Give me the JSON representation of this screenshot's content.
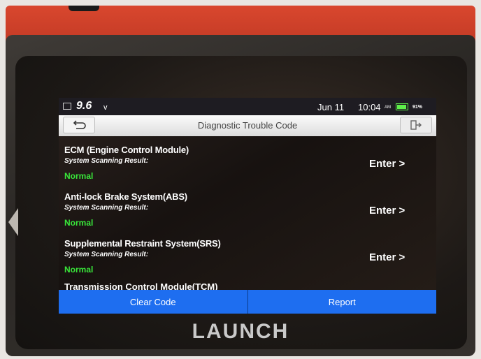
{
  "status_bar": {
    "voltage": "9.6",
    "voltage_unit": "v",
    "date": "Jun 11",
    "time": "10:04",
    "ampm": "AM",
    "battery_percent": "91%",
    "battery_level": 0.91
  },
  "header": {
    "title": "Diagnostic Trouble Code",
    "back_icon": "back-arrow-icon",
    "exit_icon": "exit-icon"
  },
  "modules": [
    {
      "name": "ECM (Engine Control Module)",
      "subtitle": "System Scanning Result:",
      "result": "Normal",
      "action": "Enter >"
    },
    {
      "name": "Anti-lock Brake System(ABS)",
      "subtitle": "System Scanning Result:",
      "result": "Normal",
      "action": "Enter >"
    },
    {
      "name": "Supplemental Restraint System(SRS)",
      "subtitle": "System Scanning Result:",
      "result": "Normal",
      "action": "Enter >"
    },
    {
      "name": "Transmission Control Module(TCM)"
    }
  ],
  "buttons": {
    "clear_code": "Clear Code",
    "report": "Report"
  },
  "device": {
    "brand": "LAUNCH"
  },
  "colors": {
    "accent_blue": "#1e6ef0",
    "normal_green": "#39e63a",
    "device_red": "#c23a25"
  }
}
